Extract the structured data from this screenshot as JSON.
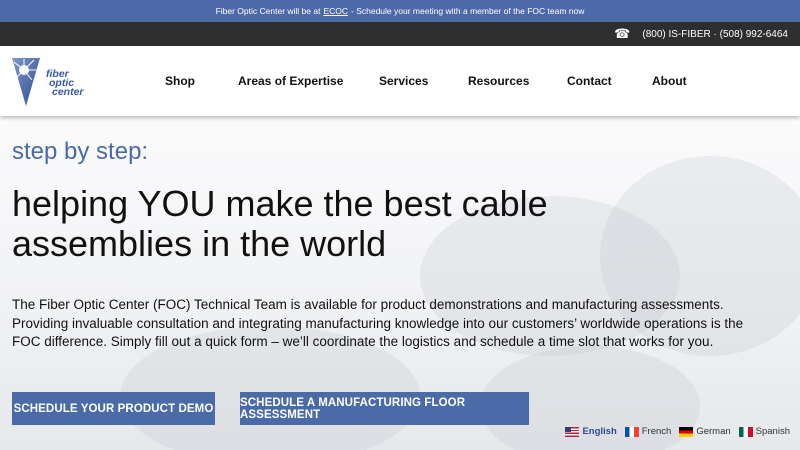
{
  "announcement": {
    "prefix": "Fiber Optic Center will be at",
    "link": "ECOC",
    "suffix": "- Schedule your meeting with a member of the FOC team now"
  },
  "topbar": {
    "phone_icon": "phone-icon",
    "phones": "(800) IS-FIBER · (508) 992-6464"
  },
  "logo": {
    "line1": "fiber",
    "line2": "optic",
    "line3": "center"
  },
  "nav": {
    "items": [
      "Shop",
      "Areas of Expertise",
      "Services",
      "Resources",
      "Contact",
      "About"
    ]
  },
  "hero": {
    "subtitle": "step by step:",
    "headline": "helping YOU make the best cable assemblies in the world",
    "description": "The Fiber Optic Center (FOC) Technical Team is available for product demonstrations and manufacturing assessments. Providing invaluable consultation and integrating manufacturing knowledge into our customers’ worldwide operations is the FOC difference. Simply fill out a quick form – we’ll coordinate the logistics and schedule a time slot that works for you.",
    "button_demo": "SCHEDULE YOUR PRODUCT DEMO",
    "button_assessment": "SCHEDULE A MANUFACTURING FLOOR ASSESSMENT"
  },
  "languages": [
    {
      "label": "English",
      "flag": "us-flag-icon"
    },
    {
      "label": "French",
      "flag": "france-flag-icon"
    },
    {
      "label": "German",
      "flag": "germany-flag-icon"
    },
    {
      "label": "Spanish",
      "flag": "mexico-flag-icon"
    }
  ],
  "colors": {
    "brand_blue": "#4a6aa8",
    "topbar_dark": "#2e2e2e",
    "announcement_bg": "#4d6aa8"
  }
}
